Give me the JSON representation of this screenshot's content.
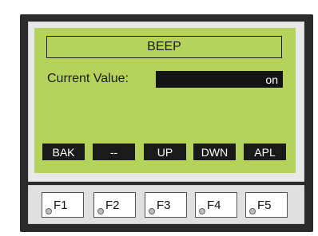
{
  "screen": {
    "title": "BEEP",
    "current_value_label": "Current Value:",
    "current_value": "on"
  },
  "softkeys": [
    {
      "label": "BAK"
    },
    {
      "label": "--"
    },
    {
      "label": "UP"
    },
    {
      "label": "DWN"
    },
    {
      "label": "APL"
    }
  ],
  "function_keys": [
    {
      "label": "F1"
    },
    {
      "label": "F2"
    },
    {
      "label": "F3"
    },
    {
      "label": "F4"
    },
    {
      "label": "F5"
    }
  ],
  "colors": {
    "bezel": "#2b2b2b",
    "lcd_background": "#b5d35a",
    "lcd_text": "#1a1a1a",
    "softkey_background": "#1a1a1a",
    "softkey_text": "#ffffff"
  }
}
